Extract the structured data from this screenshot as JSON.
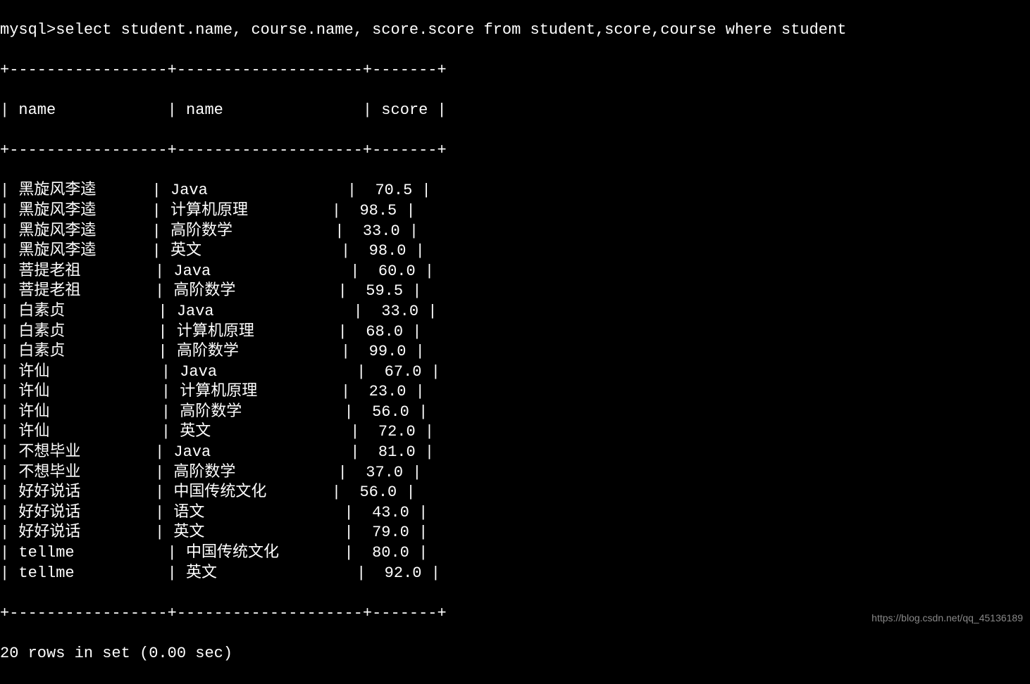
{
  "prompt": "mysql>",
  "query": "select student.name, course.name, score.score from student,score,course where student",
  "table": {
    "headers": [
      "name",
      "name",
      "score"
    ],
    "rows": [
      {
        "student_name": "黑旋风李逵",
        "course_name": "Java",
        "score": "70.5"
      },
      {
        "student_name": "黑旋风李逵",
        "course_name": "计算机原理",
        "score": "98.5"
      },
      {
        "student_name": "黑旋风李逵",
        "course_name": "高阶数学",
        "score": "33.0"
      },
      {
        "student_name": "黑旋风李逵",
        "course_name": "英文",
        "score": "98.0"
      },
      {
        "student_name": "菩提老祖",
        "course_name": "Java",
        "score": "60.0"
      },
      {
        "student_name": "菩提老祖",
        "course_name": "高阶数学",
        "score": "59.5"
      },
      {
        "student_name": "白素贞",
        "course_name": "Java",
        "score": "33.0"
      },
      {
        "student_name": "白素贞",
        "course_name": "计算机原理",
        "score": "68.0"
      },
      {
        "student_name": "白素贞",
        "course_name": "高阶数学",
        "score": "99.0"
      },
      {
        "student_name": "许仙",
        "course_name": "Java",
        "score": "67.0"
      },
      {
        "student_name": "许仙",
        "course_name": "计算机原理",
        "score": "23.0"
      },
      {
        "student_name": "许仙",
        "course_name": "高阶数学",
        "score": "56.0"
      },
      {
        "student_name": "许仙",
        "course_name": "英文",
        "score": "72.0"
      },
      {
        "student_name": "不想毕业",
        "course_name": "Java",
        "score": "81.0"
      },
      {
        "student_name": "不想毕业",
        "course_name": "高阶数学",
        "score": "37.0"
      },
      {
        "student_name": "好好说话",
        "course_name": "中国传统文化",
        "score": "56.0"
      },
      {
        "student_name": "好好说话",
        "course_name": "语文",
        "score": "43.0"
      },
      {
        "student_name": "好好说话",
        "course_name": "英文",
        "score": "79.0"
      },
      {
        "student_name": "tellme",
        "course_name": "中国传统文化",
        "score": "80.0"
      },
      {
        "student_name": "tellme",
        "course_name": "英文",
        "score": "92.0"
      }
    ]
  },
  "result_summary": "20 rows in set (0.00 sec)",
  "watermark": "https://blog.csdn.net/qq_45136189",
  "border": {
    "top": "+-----------------+--------------------+-------+",
    "header": "| name            | name               | score |",
    "mid": "+-----------------+--------------------+-------+",
    "bottom": "+-----------------+--------------------+-------+"
  }
}
